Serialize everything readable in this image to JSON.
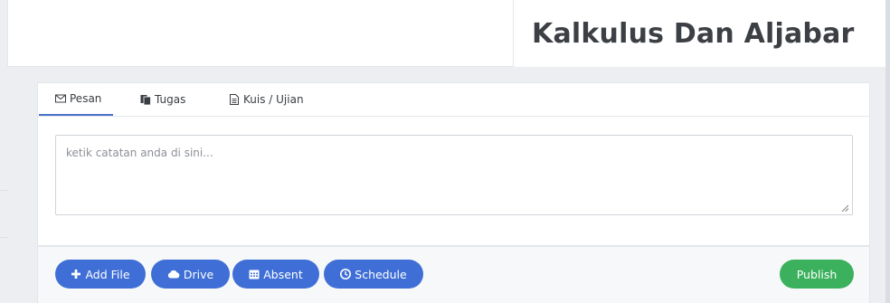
{
  "header": {
    "title": "Kalkulus Dan Aljabar"
  },
  "tabs": [
    {
      "label": "Pesan",
      "icon": "envelope-icon",
      "active": true
    },
    {
      "label": "Tugas",
      "icon": "copy-icon",
      "active": false
    },
    {
      "label": "Kuis / Ujian",
      "icon": "file-text-icon",
      "active": false
    }
  ],
  "editor": {
    "placeholder": "ketik catatan anda di sini...",
    "value": ""
  },
  "actions": [
    {
      "label": "Add File",
      "icon": "plus-icon"
    },
    {
      "label": "Drive",
      "icon": "cloud-icon"
    },
    {
      "label": "Absent",
      "icon": "calendar-icon"
    },
    {
      "label": "Schedule",
      "icon": "clock-icon"
    }
  ],
  "publish": {
    "label": "Publish"
  },
  "colors": {
    "primary": "#3f6fd6",
    "success": "#3bb15d",
    "tab_active": "#4a74c9"
  }
}
